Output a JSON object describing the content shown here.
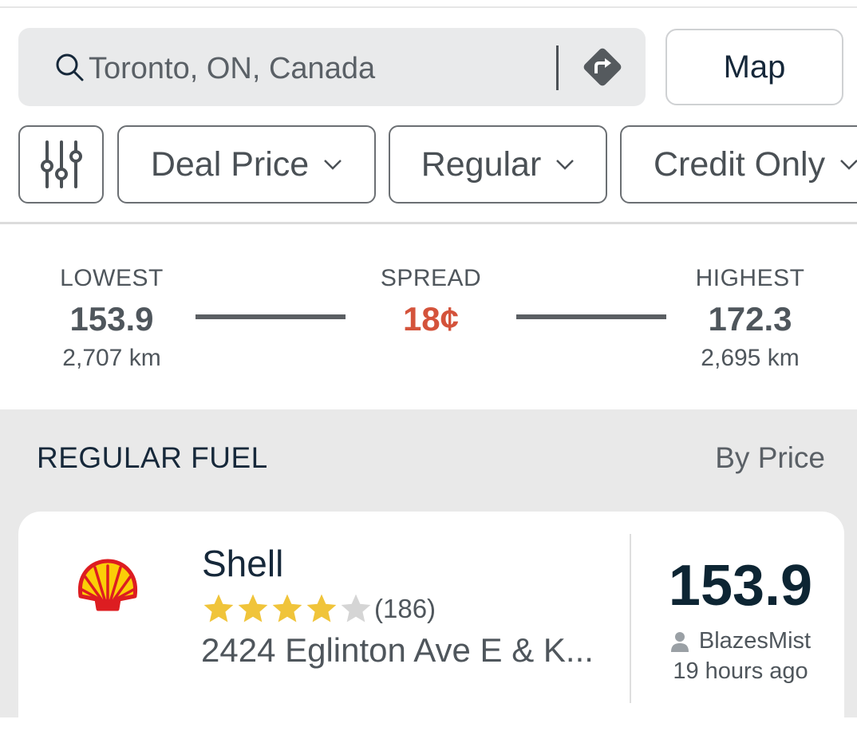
{
  "search": {
    "value": "Toronto, ON, Canada",
    "map_label": "Map"
  },
  "filters": [
    {
      "label": "Deal Price"
    },
    {
      "label": "Regular"
    },
    {
      "label": "Credit Only"
    }
  ],
  "stats": {
    "lowest": {
      "label": "LOWEST",
      "value": "153.9",
      "distance": "2,707 km"
    },
    "spread": {
      "label": "SPREAD",
      "value": "18¢"
    },
    "highest": {
      "label": "HIGHEST",
      "value": "172.3",
      "distance": "2,695 km"
    }
  },
  "list": {
    "title": "REGULAR FUEL",
    "sort_label": "By Price",
    "stations": [
      {
        "name": "Shell",
        "rating": 4,
        "max_rating": 5,
        "reviews": "(186)",
        "address": "2424 Eglinton Ave E & K...",
        "price": "153.9",
        "reporter": "BlazesMist",
        "time_ago": "19 hours ago"
      }
    ]
  },
  "colors": {
    "accent_spread": "#d4533b",
    "star_filled": "#f0c43a",
    "star_empty": "#d5d5d5",
    "shell_red": "#dd1d21",
    "shell_yellow": "#fbce07"
  },
  "icons": [
    "search-icon",
    "directions-icon",
    "filter-sliders-icon",
    "chevron-down-icon",
    "shell-logo",
    "star-icon",
    "person-icon"
  ]
}
